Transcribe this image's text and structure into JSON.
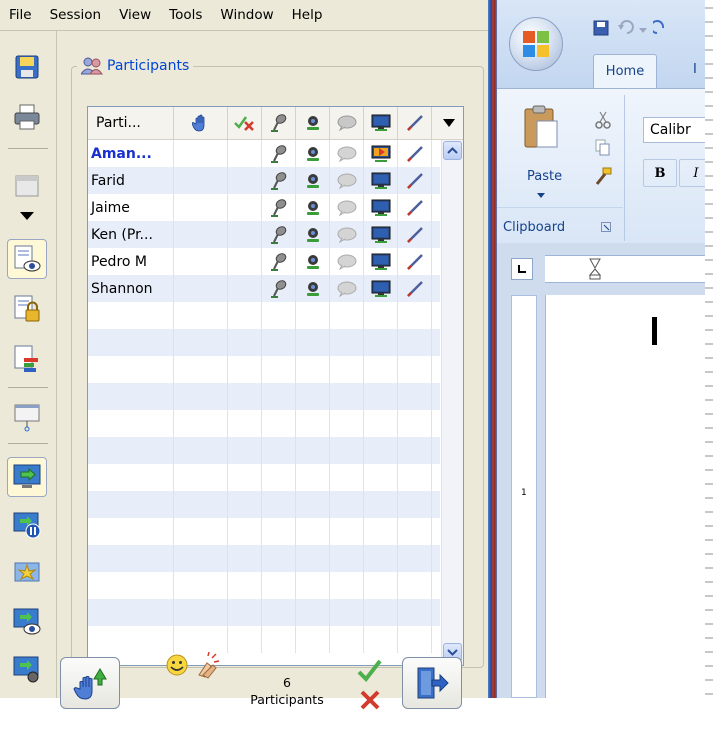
{
  "menu": [
    "File",
    "Session",
    "View",
    "Tools",
    "Window",
    "Help"
  ],
  "panel": {
    "title": "Participants",
    "name_header": "Parti...",
    "participants": [
      {
        "name": "Aman...",
        "bold": true
      },
      {
        "name": "Farid",
        "bold": false
      },
      {
        "name": "Jaime",
        "bold": false
      },
      {
        "name": "Ken (Pr...",
        "bold": false
      },
      {
        "name": "Pedro M",
        "bold": false
      },
      {
        "name": "Shannon",
        "bold": false
      }
    ],
    "count_number": "6",
    "count_label": "Participants"
  },
  "word": {
    "tab_home": "Home",
    "font_name": "Calibr",
    "paste_label": "Paste",
    "group_clipboard": "Clipboard",
    "ruler_mark": "1"
  },
  "colors": {
    "accent_blue": "#1a2fd0",
    "legend_blue": "#0046d5",
    "panel_bg": "#ece9d8",
    "row_alt": "#e8eef9"
  }
}
